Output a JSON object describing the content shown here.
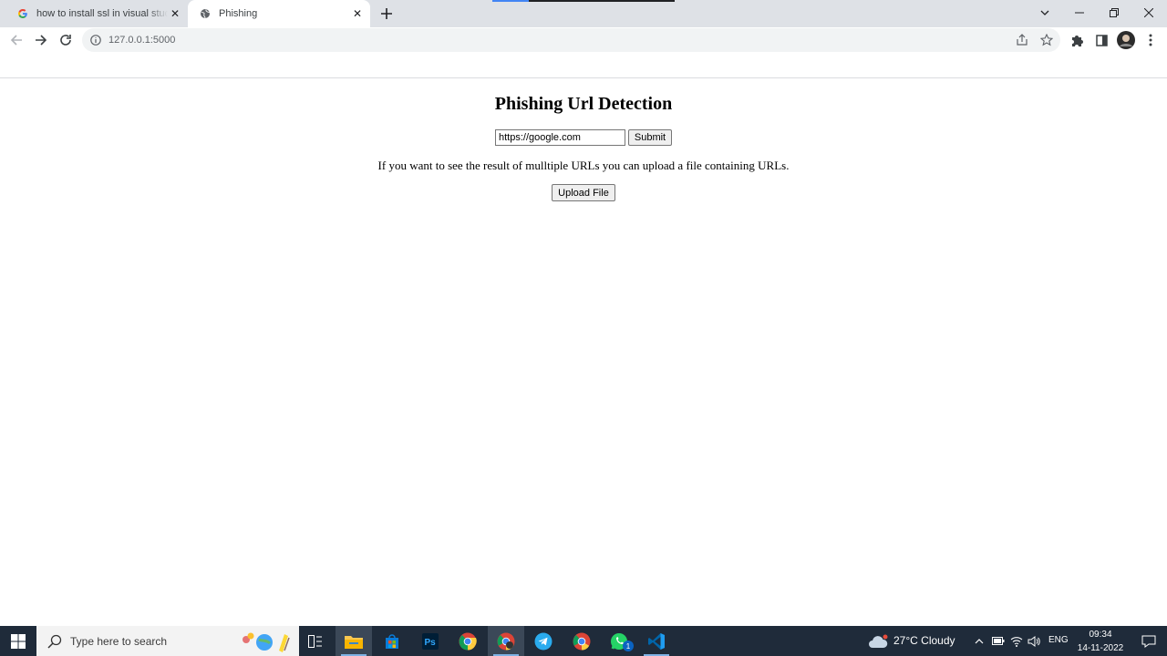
{
  "browser": {
    "tabs": [
      {
        "title": "how to install ssl in visual studio code - Google Search",
        "favicon": "google-g-icon",
        "active": false
      },
      {
        "title": "Phishing",
        "favicon": "globe-icon",
        "active": true
      }
    ],
    "address": "127.0.0.1:5000"
  },
  "page": {
    "heading": "Phishing Url Detection",
    "url_input_value": "https://google.com",
    "submit_label": "Submit",
    "info_text": "If you want to see the result of mulltiple URLs you can upload a file containing URLs.",
    "upload_label": "Upload File"
  },
  "taskbar": {
    "search_placeholder": "Type here to search",
    "apps": [
      "task-view-icon",
      "file-explorer-icon",
      "microsoft-store-icon",
      "photoshop-icon",
      "chrome-icon",
      "chrome-icon",
      "telegram-icon",
      "chrome-icon",
      "whatsapp-icon",
      "vscode-icon"
    ],
    "whatsapp_badge": "1",
    "weather": "27°C  Cloudy",
    "language": "ENG",
    "time": "09:34",
    "date": "14-11-2022"
  }
}
